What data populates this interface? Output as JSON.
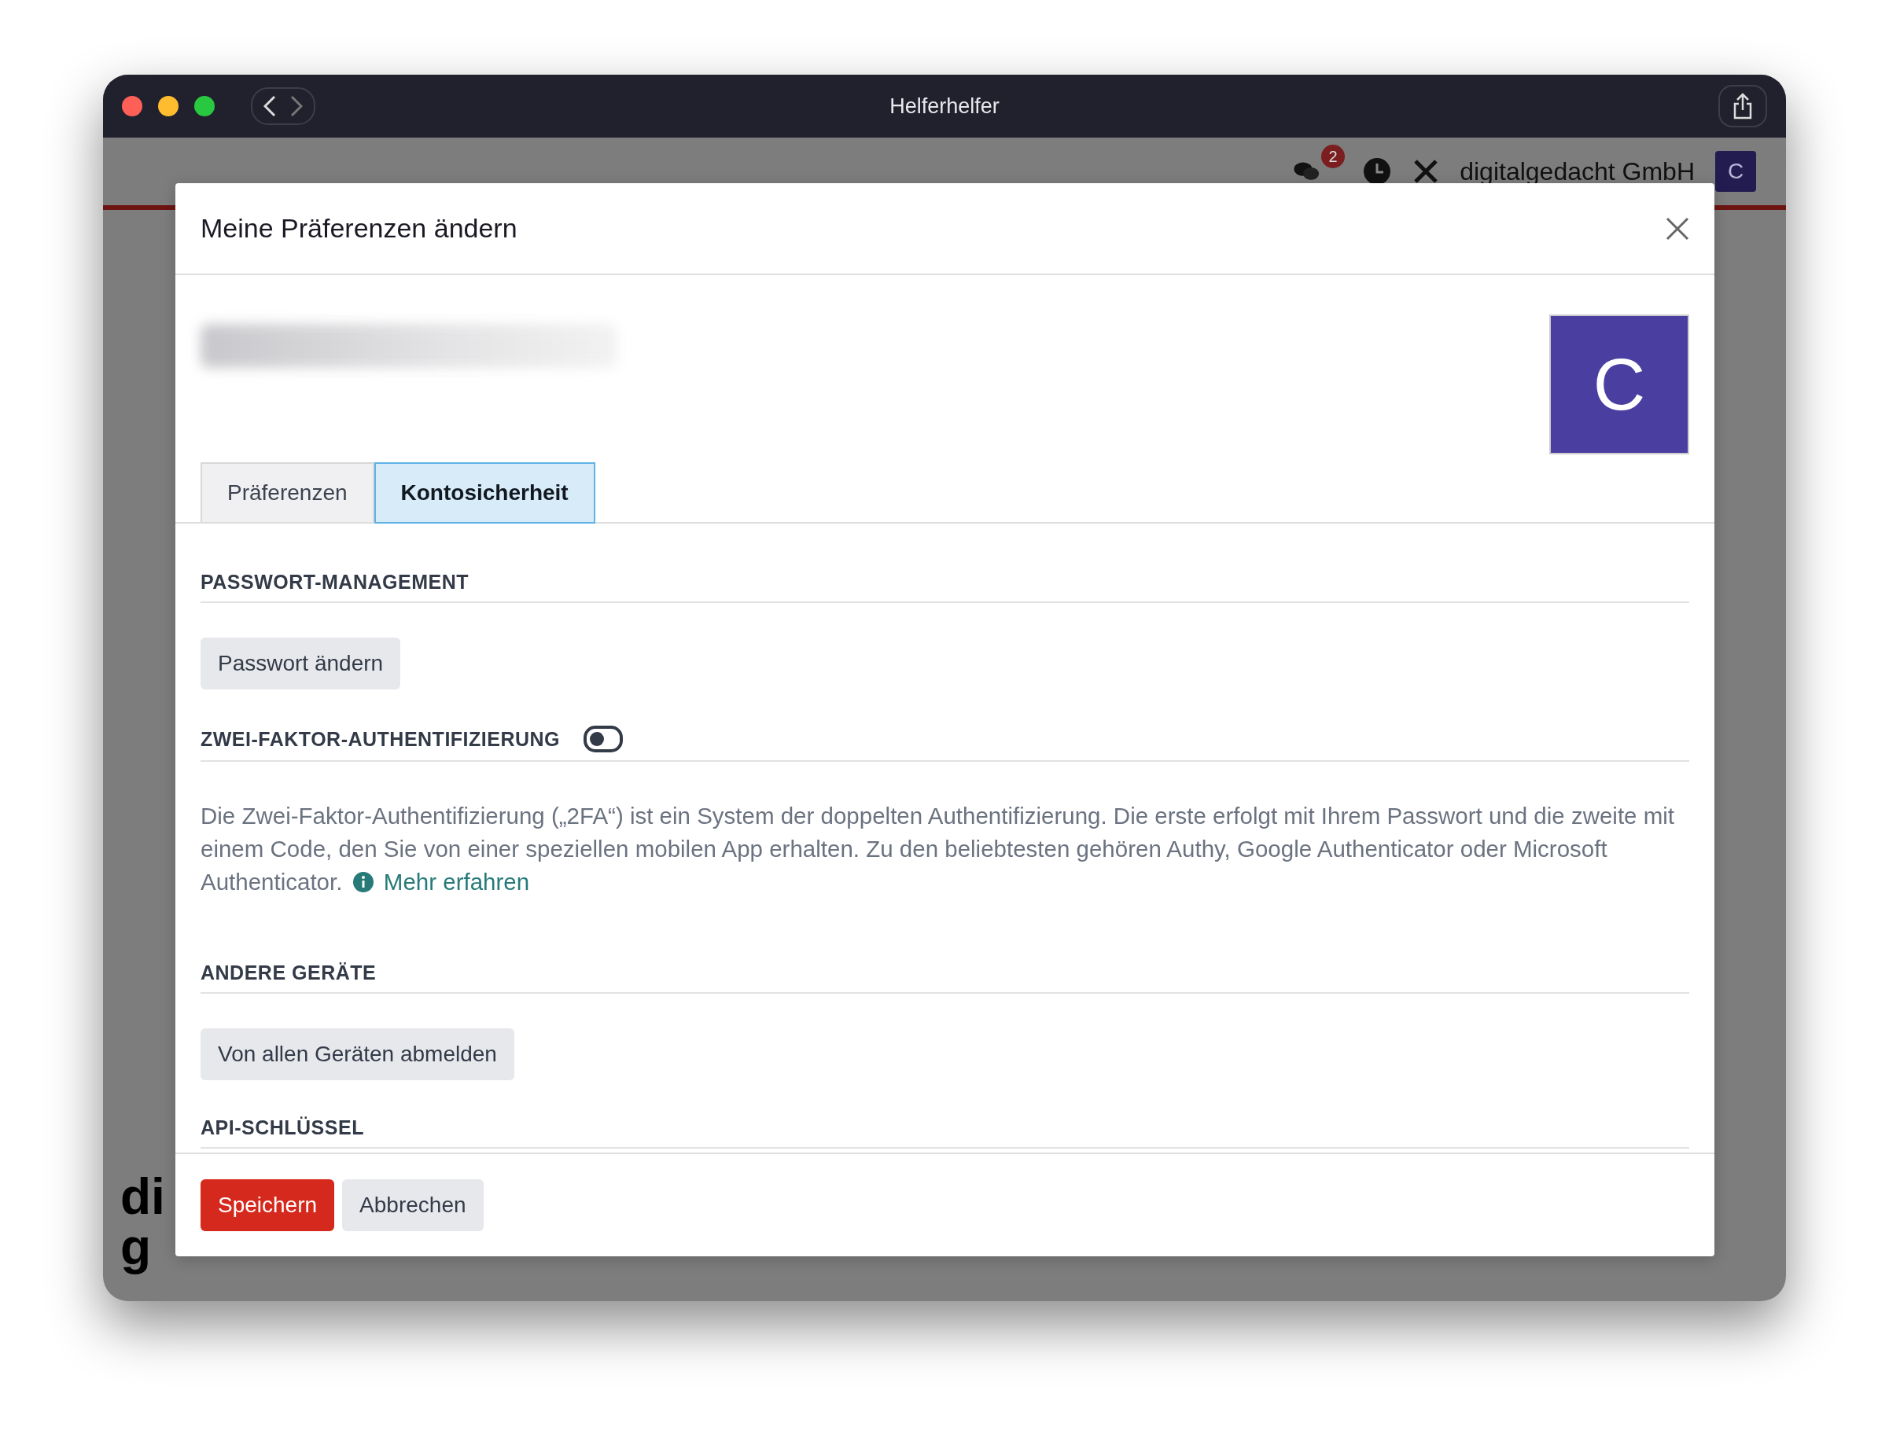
{
  "window": {
    "title": "Helferhelfer"
  },
  "app_header": {
    "chat_badge": "2",
    "company": "digitalgedacht GmbH",
    "avatar_letter": "C"
  },
  "background_logo": [
    "di",
    "g"
  ],
  "dialog": {
    "title": "Meine Präferenzen ändern",
    "avatar_letter": "C",
    "tabs": [
      {
        "label": "Präferenzen",
        "selected": false
      },
      {
        "label": "Kontosicherheit",
        "selected": true
      }
    ],
    "sections": [
      {
        "kind": "button",
        "heading": "PASSWORT-MANAGEMENT",
        "button": "Passwort ändern"
      },
      {
        "kind": "toggle",
        "heading": "ZWEI-FAKTOR-AUTHENTIFIZIERUNG",
        "on": false,
        "text": "Die Zwei-Faktor-Authentifizierung („2FA“) ist ein System der doppelten Authentifizierung. Die erste erfolgt mit Ihrem Passwort und die zweite mit einem Code, den Sie von einer speziellen mobilen App erhalten. Zu den beliebtesten gehören Authy, Google Authenticator oder Microsoft Authenticator.",
        "link": "Mehr erfahren"
      },
      {
        "kind": "button",
        "heading": "ANDERE GERÄTE",
        "button": "Von allen Geräten abmelden"
      },
      {
        "kind": "heading",
        "heading": "API-SCHLÜSSEL"
      }
    ],
    "buttons": [
      {
        "label": "Speichern",
        "primary": true
      },
      {
        "label": "Abbrechen",
        "primary": false
      }
    ]
  }
}
